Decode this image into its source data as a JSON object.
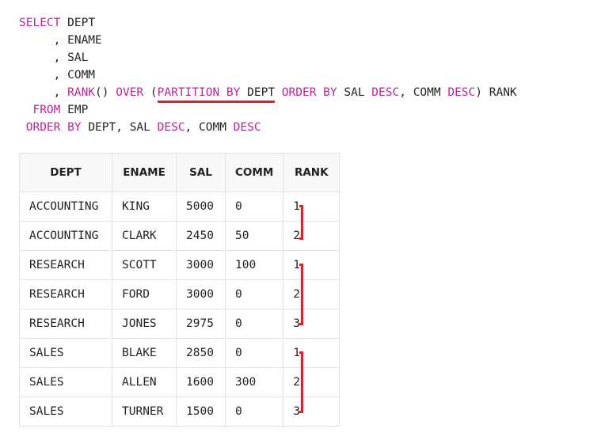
{
  "sql": {
    "select_kw": "SELECT",
    "col_dept": "DEPT",
    "col_ename": "ENAME",
    "col_sal": "SAL",
    "col_comm": "COMM",
    "rank_fn": "RANK",
    "over_kw": "OVER",
    "partition_kw": "PARTITION BY",
    "partition_col": "DEPT",
    "order_by_kw": "ORDER BY",
    "window_order_sal": "SAL",
    "desc_kw": "DESC",
    "window_order_comm": "COMM",
    "alias": "RANK",
    "from_kw": "FROM",
    "from_table": "EMP",
    "final_order_by_kw": "ORDER BY",
    "final_order_cols_1": "DEPT, SAL",
    "final_order_cols_2": "COMM"
  },
  "table": {
    "headers": [
      "DEPT",
      "ENAME",
      "SAL",
      "COMM",
      "RANK"
    ],
    "rows": [
      [
        "ACCOUNTING",
        "KING",
        "5000",
        "0",
        "1"
      ],
      [
        "ACCOUNTING",
        "CLARK",
        "2450",
        "50",
        "2"
      ],
      [
        "RESEARCH",
        "SCOTT",
        "3000",
        "100",
        "1"
      ],
      [
        "RESEARCH",
        "FORD",
        "3000",
        "0",
        "2"
      ],
      [
        "RESEARCH",
        "JONES",
        "2975",
        "0",
        "3"
      ],
      [
        "SALES",
        "BLAKE",
        "2850",
        "0",
        "1"
      ],
      [
        "SALES",
        "ALLEN",
        "1600",
        "300",
        "2"
      ],
      [
        "SALES",
        "TURNER",
        "1500",
        "0",
        "3"
      ]
    ]
  },
  "colors": {
    "keyword": "#c0219c",
    "highlight": "#e0202a",
    "text": "#222222",
    "grid": "#e3e3e3"
  }
}
